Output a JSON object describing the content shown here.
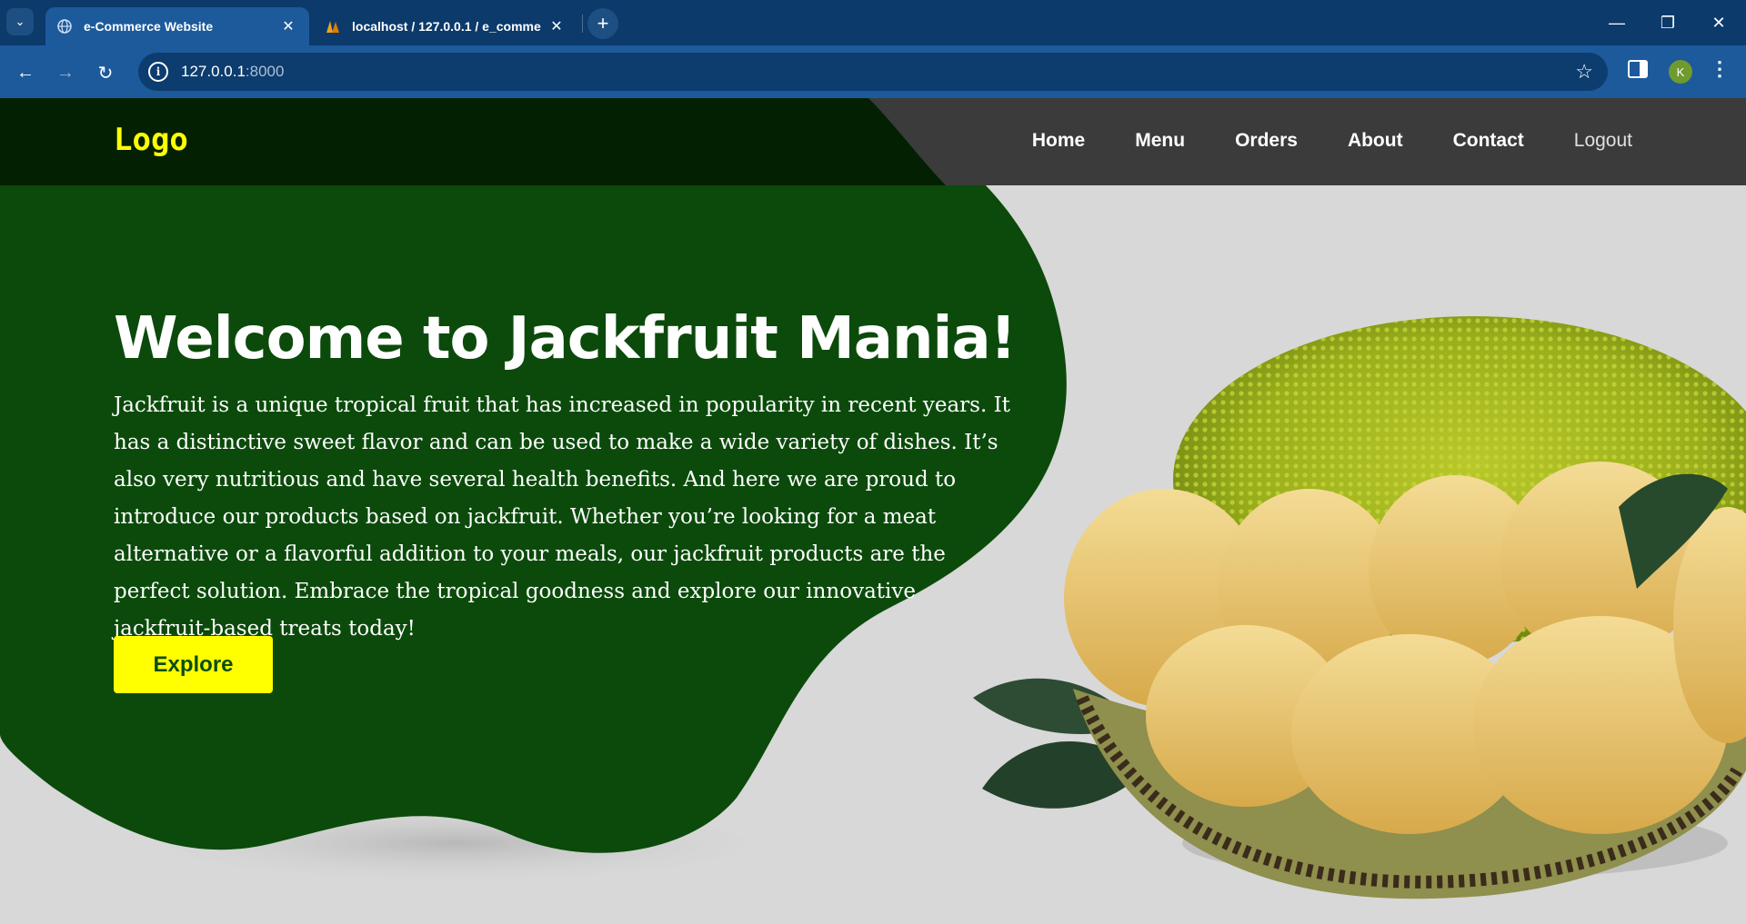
{
  "browser": {
    "tabs": [
      {
        "title": "e-Commerce Website",
        "active": true
      },
      {
        "title": "localhost / 127.0.0.1 / e_comme",
        "active": false
      }
    ],
    "url_host": "127.0.0.1",
    "url_port": ":8000",
    "profile_initial": "K"
  },
  "site": {
    "logo": "Logo",
    "nav": [
      "Home",
      "Menu",
      "Orders",
      "About",
      "Contact",
      "Logout"
    ],
    "hero": {
      "title": "Welcome to Jackfruit Mania!",
      "text": "Jackfruit is a unique tropical fruit that has increased in popularity in recent years. It has a distinctive sweet flavor and can be used to make a wide variety of dishes. It’s also very nutritious and have several health benefits. And here we are proud to introduce our products based on jackfruit. Whether you’re looking for a meat alternative or a flavorful addition to your meals, our jackfruit products are the perfect solution. Embrace the tropical goodness and explore our innovative jackfruit-based treats today!",
      "button": "Explore"
    }
  },
  "colors": {
    "brand_green": "#0a4d0a",
    "logo_yellow": "#ffff00",
    "header_dark": "#3b3b3b",
    "chrome_blue": "#1c5a9b"
  }
}
